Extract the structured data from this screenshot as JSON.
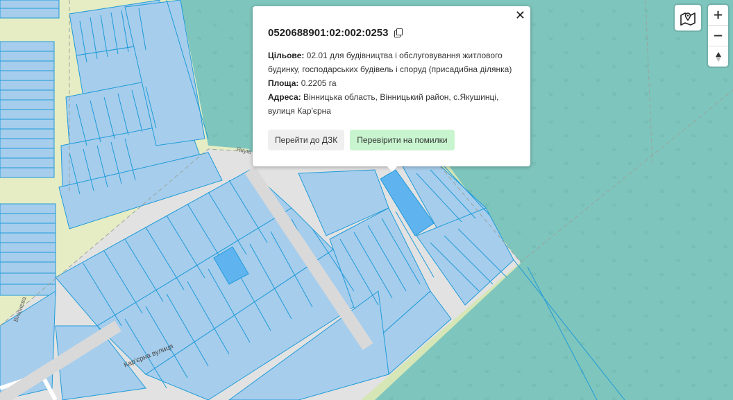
{
  "map": {
    "street_label_main": "Кар'єрна вулиця",
    "street_label_vertical": "Вишнева",
    "street_label_top": "Якуш"
  },
  "popup": {
    "cadastral_number": "0520688901:02:002:0253",
    "purpose_label": "Цільове:",
    "purpose_value": "02.01 для будівництва і обслуговування житлового будинку, господарських будівель і споруд (присадибна ділянка)",
    "area_label": "Площа:",
    "area_value": "0.2205 га",
    "address_label": "Адреса:",
    "address_value": "Вінницька область, Вінницький район, с.Якушинці, вулиця Кар'єрна",
    "btn_dzk": "Перейти до ДЗК",
    "btn_check": "Перевірити на помилки",
    "close": "✕"
  },
  "controls": {
    "zoom_in": "+",
    "zoom_out": "−",
    "compass": "▲",
    "layers_icon": "map-pin-layers-icon"
  },
  "colors": {
    "forest": "#7ec5bd",
    "parcel_fill": "#a6cdec",
    "parcel_stroke": "#1f9bd8",
    "parcel_selected": "#5fb4f0",
    "road": "#dcdcdc",
    "meadow": "#e6ecc4"
  }
}
